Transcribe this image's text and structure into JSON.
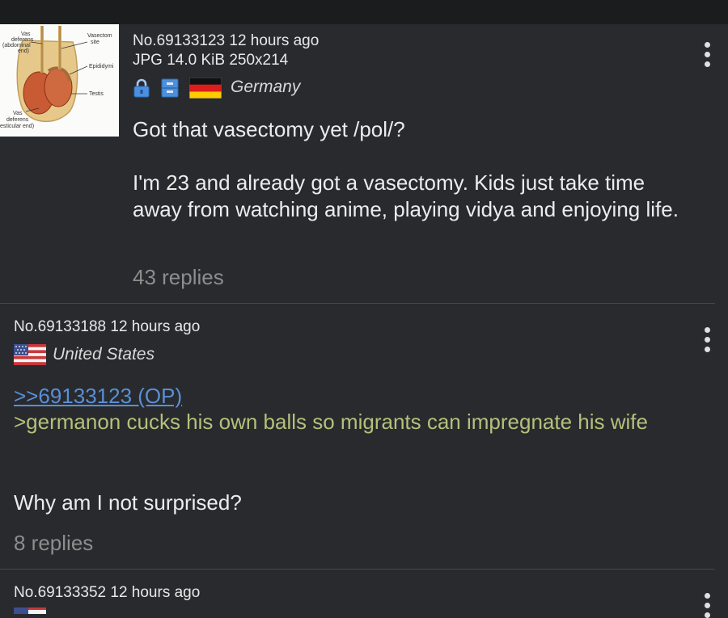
{
  "posts": [
    {
      "number_line": "No.69133123 12 hours ago",
      "file_line": "JPG 14.0 KiB 250x214",
      "country": "Germany",
      "body": [
        "Got that vasectomy yet /pol/?",
        "I'm 23 and already got a vasectomy. Kids just take time away from watching anime, playing vidya and enjoying life."
      ],
      "replies": "43 replies",
      "thumbnail": {
        "labels": {
          "vas_def_abd_1": "Vas",
          "vas_def_abd_2": "deferens",
          "vas_def_abd_3": "(abdominal",
          "vas_def_abd_4": "end)",
          "vasectomy_site_1": "Vasectom",
          "vasectomy_site_2": "site",
          "epididymis": "Epididymi",
          "testis": "Testis",
          "vas_def_test_1": "Vas",
          "vas_def_test_2": "deferens",
          "vas_def_test_3": "esticular end)"
        }
      }
    },
    {
      "number_line": "No.69133188 12 hours ago",
      "country": "United States",
      "quote_link": ">>69133123 (OP)",
      "greentext": ">germanon cucks his own balls so migrants can impregnate his wife",
      "body": [
        "Why am I not surprised?"
      ],
      "replies": "8 replies"
    },
    {
      "number_line": "No.69133352 12 hours ago"
    }
  ],
  "colors": {
    "background": "#282a2e",
    "greentext": "#b5c07a",
    "quote_link": "#5a8fd6",
    "muted": "#8d8d8d"
  },
  "icons": [
    "lock-icon",
    "archive-icon",
    "flag-germany-icon",
    "flag-usa-icon",
    "kebab-menu-icon"
  ]
}
